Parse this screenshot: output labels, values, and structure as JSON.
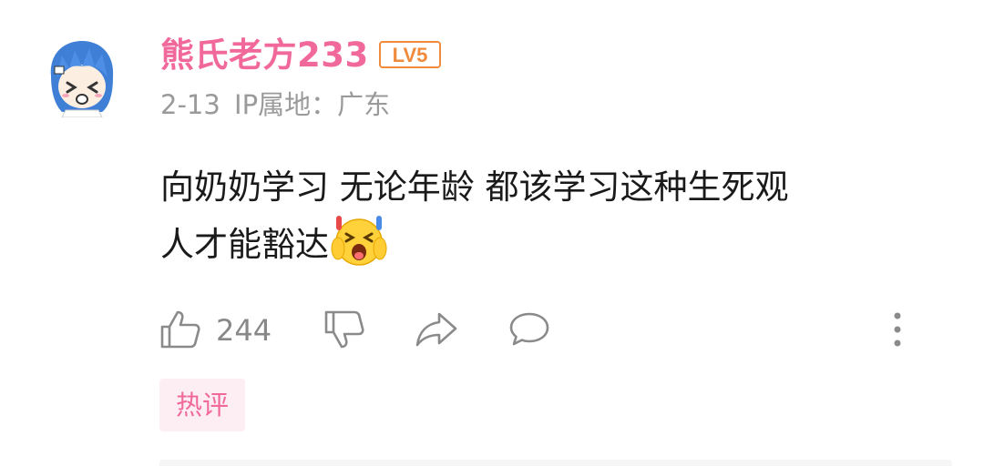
{
  "comment": {
    "username": "熊氏老方233",
    "level_badge": "LV5",
    "date": "2-13",
    "ip_location": "IP属地：广东",
    "text_line1": "向奶奶学习 无论年龄 都该学习这种生死观",
    "text_line2": "人才能豁达",
    "emoji": "emoji-shocked-face",
    "like_count": "244",
    "tag": "热评"
  },
  "colors": {
    "username": "#f0699a",
    "level_badge": "#f08a3c",
    "meta_text": "#9a9a9a",
    "icon_gray": "#8a8a8a",
    "tag_bg": "#fdeef3",
    "tag_text": "#f0699a"
  },
  "icons": [
    "avatar",
    "level-badge-icon",
    "thumbs-up-icon",
    "thumbs-down-icon",
    "share-icon",
    "comment-icon",
    "more-icon"
  ]
}
